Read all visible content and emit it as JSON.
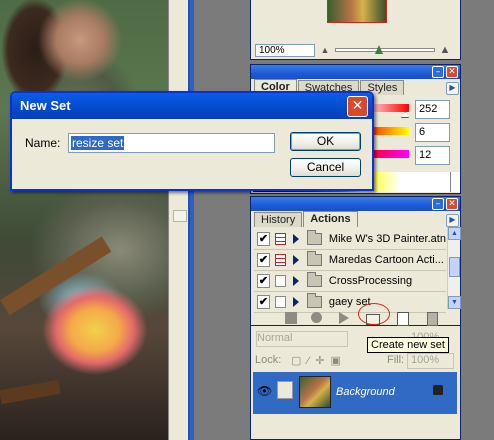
{
  "navigator": {
    "zoom": "100%"
  },
  "color": {
    "tabs": [
      "Color",
      "Swatches",
      "Styles"
    ],
    "values": [
      "252",
      "6",
      "12"
    ],
    "colors": {
      "r_end": "#ff0000",
      "g_end": "#ffff00",
      "b_end": "#ff00ff"
    }
  },
  "actions": {
    "tabs": [
      "History",
      "Actions"
    ],
    "items": [
      {
        "checked": "✔",
        "dialog": true,
        "label": "Mike W's 3D Painter.atn"
      },
      {
        "checked": "✔",
        "dialog": true,
        "label": "Maredas Cartoon Acti..."
      },
      {
        "checked": "✔",
        "dialog": false,
        "label": "CrossProcessing"
      },
      {
        "checked": "✔",
        "dialog": false,
        "label": "gaey set"
      }
    ],
    "tooltip": "Create new set"
  },
  "layers": {
    "blend_mode": "Normal",
    "opacity_label": "100%",
    "lock_label": "Lock:",
    "fill_label": "Fill:",
    "fill_value": "100%",
    "layer_name": "Background"
  },
  "dialog": {
    "title": "New Set",
    "name_label": "Name:",
    "name_value": "resize set",
    "ok_label": "OK",
    "cancel_label": "Cancel"
  },
  "theme": {
    "accent": "#316ac5",
    "titlebar": "#0446c8",
    "close": "#d9482b"
  }
}
